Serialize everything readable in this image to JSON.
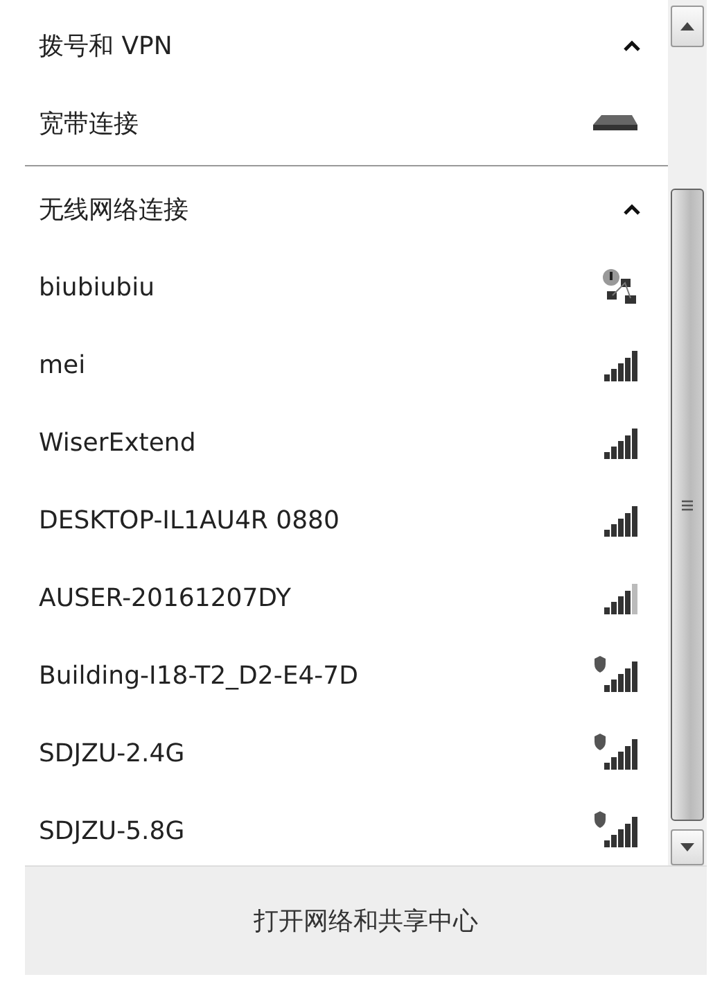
{
  "sections": [
    {
      "title": "拨号和 VPN",
      "expanded": true,
      "items": [
        {
          "name": "宽带连接",
          "kind": "broadband"
        }
      ]
    },
    {
      "title": "无线网络连接",
      "expanded": true,
      "items": [
        {
          "name": "biubiubiu",
          "kind": "network"
        },
        {
          "name": "mei",
          "kind": "open"
        },
        {
          "name": "WiserExtend",
          "kind": "open"
        },
        {
          "name": "DESKTOP-IL1AU4R 0880",
          "kind": "open"
        },
        {
          "name": "AUSER-20161207DY",
          "kind": "weaker"
        },
        {
          "name": "Building-I18-T2_D2-E4-7D",
          "kind": "secured"
        },
        {
          "name": "SDJZU-2.4G",
          "kind": "secured"
        },
        {
          "name": "SDJZU-5.8G",
          "kind": "secured"
        }
      ]
    }
  ],
  "footer_link": "打开网络和共享中心"
}
